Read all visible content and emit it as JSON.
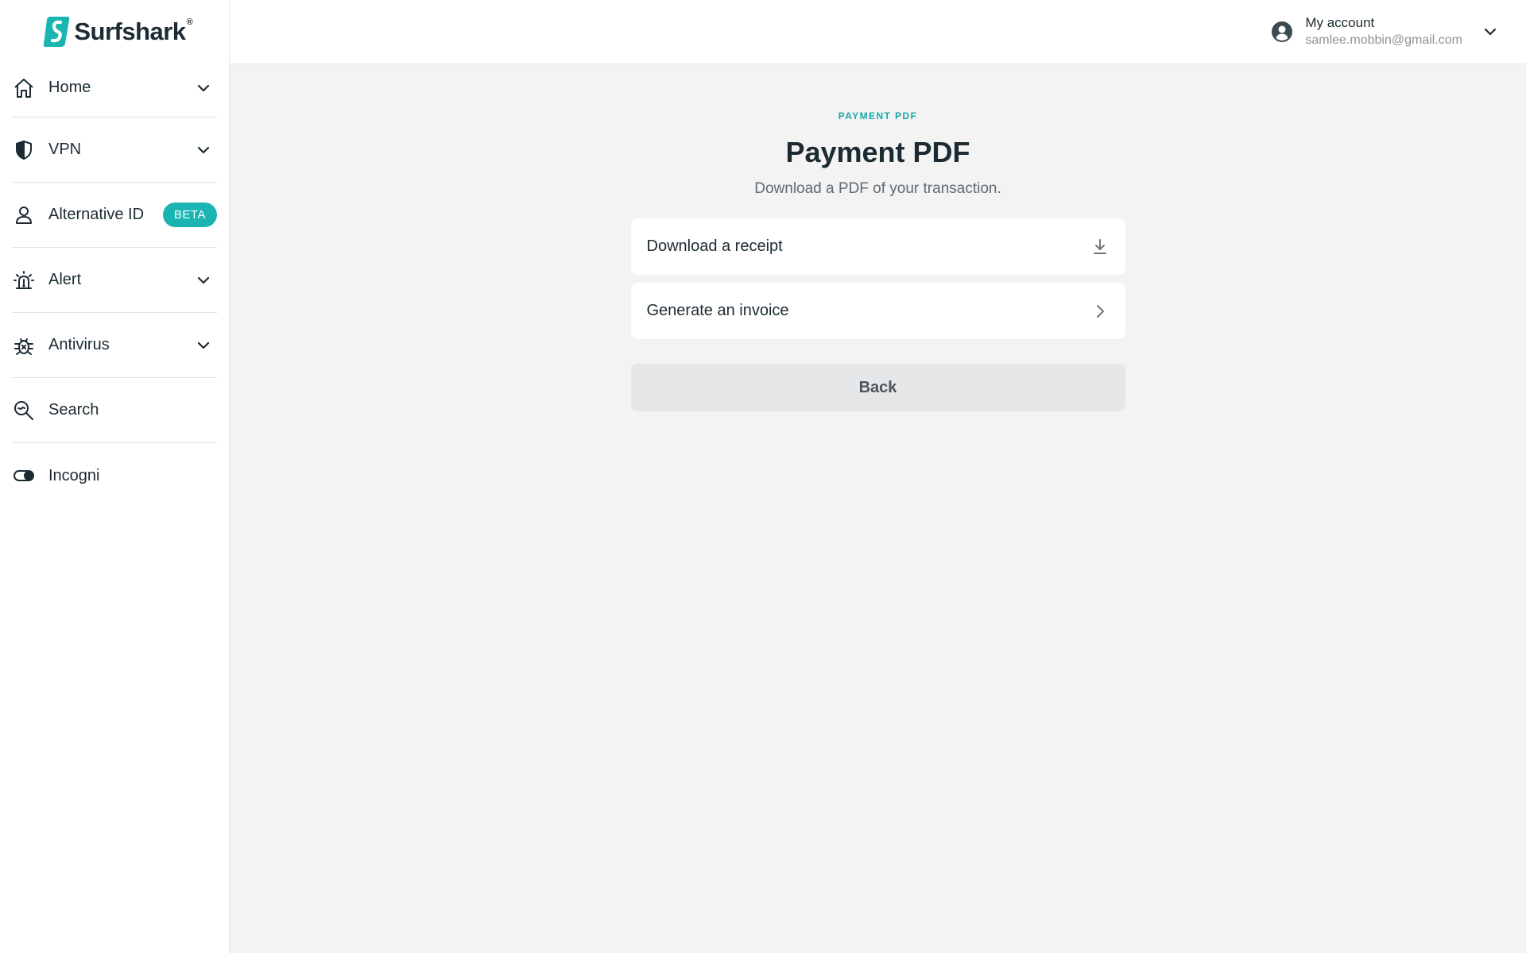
{
  "brand": {
    "name": "Surfshark",
    "registered": "®",
    "accent": "#1ab5b3"
  },
  "sidebar": {
    "items": [
      {
        "label": "Home",
        "icon": "home-icon",
        "expandable": true
      },
      {
        "label": "VPN",
        "icon": "shield-icon",
        "expandable": true
      },
      {
        "label": "Alternative ID",
        "icon": "person-icon",
        "badge": "BETA"
      },
      {
        "label": "Alert",
        "icon": "alarm-icon",
        "expandable": true
      },
      {
        "label": "Antivirus",
        "icon": "bug-icon",
        "expandable": true
      },
      {
        "label": "Search",
        "icon": "search-icon"
      },
      {
        "label": "Incogni",
        "icon": "toggle-icon"
      }
    ]
  },
  "header": {
    "account_title": "My account",
    "account_email": "samlee.mobbin@gmail.com"
  },
  "main": {
    "eyebrow": "PAYMENT PDF",
    "title": "Payment PDF",
    "subtitle": "Download a PDF of your transaction.",
    "options": [
      {
        "label": "Download a receipt",
        "icon": "download-icon"
      },
      {
        "label": "Generate an invoice",
        "icon": "chevron-right-icon"
      }
    ],
    "back_label": "Back"
  }
}
